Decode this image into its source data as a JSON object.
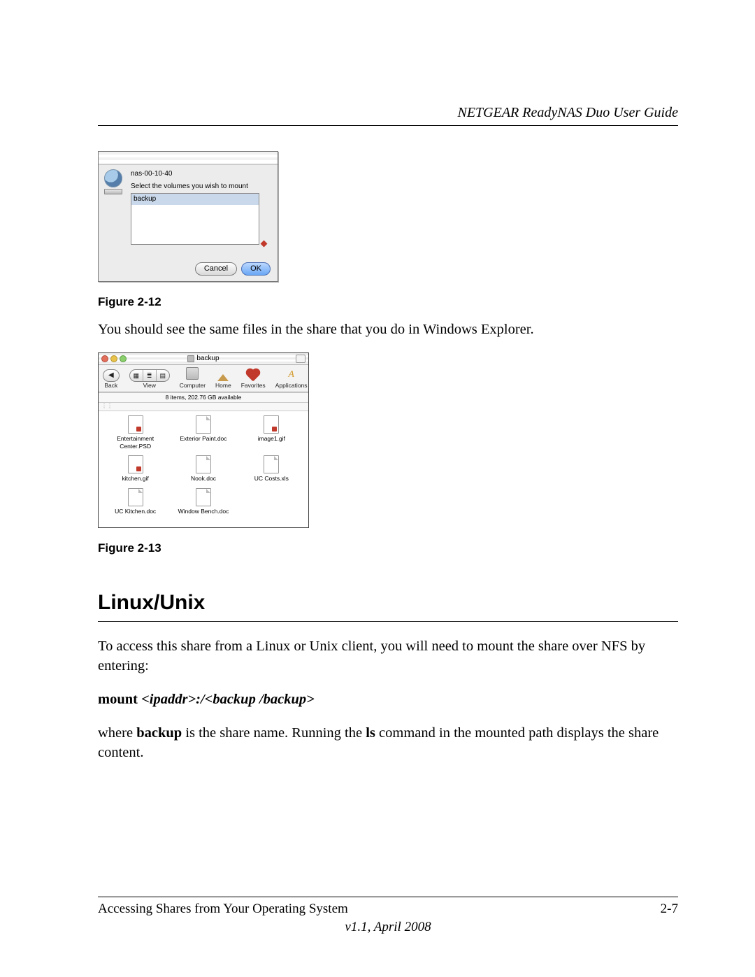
{
  "header": {
    "title": "NETGEAR ReadyNAS Duo User Guide"
  },
  "dialog1": {
    "host": "nas-00-10-40",
    "prompt": "Select the volumes you wish to mount",
    "selected_volume": "backup",
    "btn_cancel": "Cancel",
    "btn_ok": "OK"
  },
  "fig12_caption": "Figure 2-12",
  "body1": "You should see the same files in the share that you do in Windows Explorer.",
  "finder": {
    "title": "backup",
    "toolbar": {
      "back": "Back",
      "view": "View",
      "computer": "Computer",
      "home": "Home",
      "favorites": "Favorites",
      "applications": "Applications"
    },
    "status": "8 items, 202.76 GB available",
    "files": [
      "Entertainment Center.PSD",
      "Exterior Paint.doc",
      "image1.gif",
      "kitchen.gif",
      "Nook.doc",
      "UC Costs.xls",
      "UC Kitchen.doc",
      "Window Bench.doc"
    ]
  },
  "fig13_caption": "Figure 2-13",
  "section_heading": "Linux/Unix",
  "body2": "To access this share from a Linux or Unix client, you will need to mount the share over NFS by entering:",
  "cmd": {
    "pre": "mount ",
    "arg": "<ipaddr>:/<backup /backup>"
  },
  "body3a": "where ",
  "body3b": "backup",
  "body3c": " is the share name. Running the ",
  "body3d": "ls",
  "body3e": " command in the mounted path displays the share content.",
  "footer": {
    "left": "Accessing Shares from Your Operating System",
    "right": "2-7",
    "version": "v1.1, April 2008"
  }
}
